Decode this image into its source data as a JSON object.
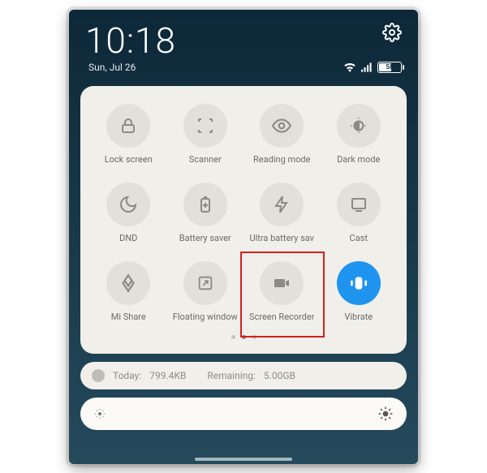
{
  "status": {
    "time": "10:18",
    "date": "Sun, Jul 26",
    "battery_pct": "58"
  },
  "tiles": [
    {
      "id": "lock-screen",
      "label": "Lock screen",
      "icon": "lock",
      "active": false
    },
    {
      "id": "scanner",
      "label": "Scanner",
      "icon": "scanner",
      "active": false
    },
    {
      "id": "reading-mode",
      "label": "Reading mode",
      "icon": "eye",
      "active": false
    },
    {
      "id": "dark-mode",
      "label": "Dark mode",
      "icon": "darkmode",
      "active": false
    },
    {
      "id": "dnd",
      "label": "DND",
      "icon": "moon",
      "active": false
    },
    {
      "id": "battery-saver",
      "label": "Battery saver",
      "icon": "battery-plus",
      "active": false
    },
    {
      "id": "ultra-battery",
      "label": "Ultra battery sav",
      "icon": "bolt",
      "active": false
    },
    {
      "id": "cast",
      "label": "Cast",
      "icon": "cast",
      "active": false
    },
    {
      "id": "mi-share",
      "label": "Mi Share",
      "icon": "mishare",
      "active": false
    },
    {
      "id": "floating-window",
      "label": "Floating window",
      "icon": "floating",
      "active": false
    },
    {
      "id": "screen-recorder",
      "label": "Screen Recorder",
      "icon": "camera",
      "active": false,
      "highlight": true
    },
    {
      "id": "vibrate",
      "label": "Vibrate",
      "icon": "vibrate",
      "active": true
    }
  ],
  "pagination": {
    "total": 3,
    "active": 1
  },
  "data_usage": {
    "today_label": "Today:",
    "today_value": "799.4KB",
    "remaining_label": "Remaining:",
    "remaining_value": "5.00GB"
  }
}
